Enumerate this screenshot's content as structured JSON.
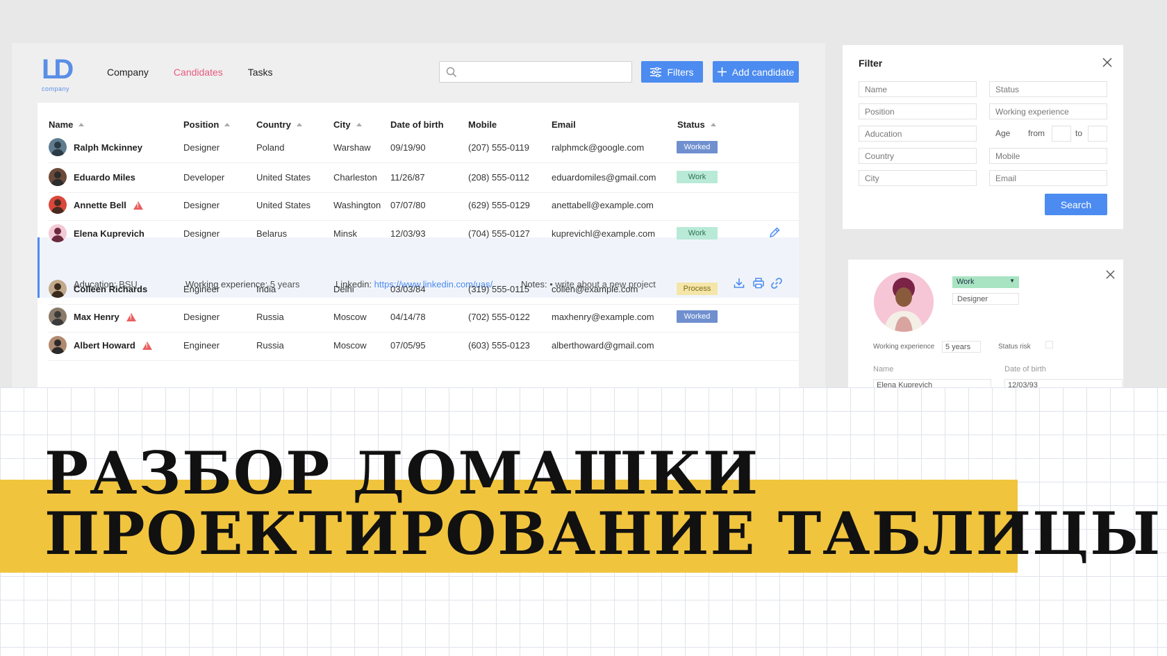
{
  "logo": {
    "mark": "LD",
    "sub": "company"
  },
  "nav": {
    "items": [
      "Company",
      "Candidates",
      "Tasks"
    ],
    "active": "Candidates"
  },
  "search": {
    "placeholder": ""
  },
  "toolbar": {
    "filters_label": "Filters",
    "add_label": "Add candidate"
  },
  "table": {
    "columns": [
      "Name",
      "Position",
      "Country",
      "City",
      "Date of birth",
      "Mobile",
      "Email",
      "Status"
    ],
    "rows": [
      {
        "name": "Ralph Mckinney",
        "position": "Designer",
        "country": "Poland",
        "city": "Warshaw",
        "dob": "09/19/90",
        "mobile": "(207) 555-0119",
        "email": "ralphmck@google.com",
        "status": "Worked",
        "warn": false
      },
      {
        "name": "Eduardo Miles",
        "position": "Developer",
        "country": "United States",
        "city": "Charleston",
        "dob": "11/26/87",
        "mobile": "(208) 555-0112",
        "email": "eduardomiles@gmail.com",
        "status": "Work",
        "warn": false
      },
      {
        "name": "Annette Bell",
        "position": "Designer",
        "country": "United States",
        "city": "Washington",
        "dob": "07/07/80",
        "mobile": "(629) 555-0129",
        "email": "anettabell@example.com",
        "status": "",
        "warn": true
      },
      {
        "name": "Elena Kuprevich",
        "position": "Designer",
        "country": "Belarus",
        "city": "Minsk",
        "dob": "12/03/93",
        "mobile": "(704) 555-0127",
        "email": "kuprevichl@example.com",
        "status": "Work",
        "warn": false
      },
      {
        "name": "Colleen Richards",
        "position": "Engineer",
        "country": "India",
        "city": "Delhi",
        "dob": "03/03/84",
        "mobile": "(319) 555-0115",
        "email": "collen@example.com",
        "status": "Process",
        "warn": false
      },
      {
        "name": "Max Henry",
        "position": "Designer",
        "country": "Russia",
        "city": "Moscow",
        "dob": "04/14/78",
        "mobile": "(702) 555-0122",
        "email": "maxhenry@example.com",
        "status": "Worked",
        "warn": true
      },
      {
        "name": "Albert Howard",
        "position": "Engineer",
        "country": "Russia",
        "city": "Moscow",
        "dob": "07/05/95",
        "mobile": "(603) 555-0123",
        "email": "alberthoward@gmail.com",
        "status": "",
        "warn": true
      }
    ],
    "expanded": {
      "education_label": "Aducation:",
      "education": "BSU",
      "experience_label": "Working experience:",
      "experience": "5 years",
      "linkedin_label": "Linkedin:",
      "linkedin": "https://www.linkedin.com/uas/",
      "notes_label": "Notes:",
      "notes": "• write about a new project"
    }
  },
  "filter": {
    "title": "Filter",
    "fields_left": [
      "Name",
      "Position",
      "Aducation",
      "Country",
      "City"
    ],
    "fields_right": [
      "Status",
      "Working experience",
      "Mobile",
      "Email"
    ],
    "age_label": "Age",
    "from_label": "from",
    "to_label": "to",
    "search_label": "Search"
  },
  "profile": {
    "status": "Work",
    "position": "Designer",
    "experience_label": "Working experience",
    "experience": "5 years",
    "status_risk_label": "Status risk",
    "name_label": "Name",
    "name": "Elena Kuprevich",
    "dob_label": "Date of birth",
    "dob": "12/03/93"
  },
  "banner": {
    "line1": "РАЗБОР  ДОМАШКИ",
    "line2": "ПРОЕКТИРОВАНИЕ  ТАБЛИЦЫ"
  },
  "colors": {
    "accent": "#4c8bf0",
    "active_nav": "#e85b7e",
    "banner_yellow": "#f1c43e",
    "worked": "#6f8fcf",
    "work": "#b9ead7",
    "process": "#f4e6a8"
  }
}
